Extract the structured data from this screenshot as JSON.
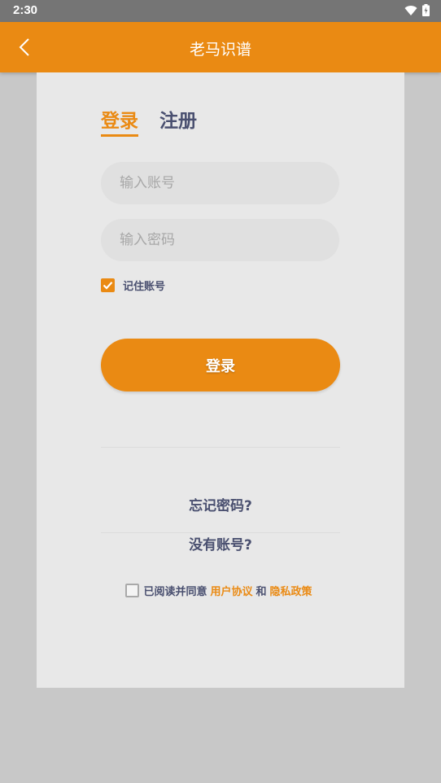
{
  "status_bar": {
    "time": "2:30"
  },
  "app_bar": {
    "title": "老马识谱"
  },
  "tabs": {
    "login": "登录",
    "register": "注册"
  },
  "form": {
    "account_placeholder": "输入账号",
    "password_placeholder": "输入密码",
    "remember_label": "记住账号",
    "remember_checked": true,
    "login_button": "登录"
  },
  "links": {
    "forgot_password": "忘记密码?",
    "no_account": "没有账号?"
  },
  "agreement": {
    "checked": false,
    "prefix": "已阅读并同意",
    "user_agreement": "用户协议",
    "and": "和",
    "privacy_policy": "隐私政策"
  },
  "colors": {
    "accent": "#ea8a13",
    "text_dark": "#4a5070",
    "card_bg": "#e8e8e8",
    "page_bg": "#c8c8c8"
  }
}
